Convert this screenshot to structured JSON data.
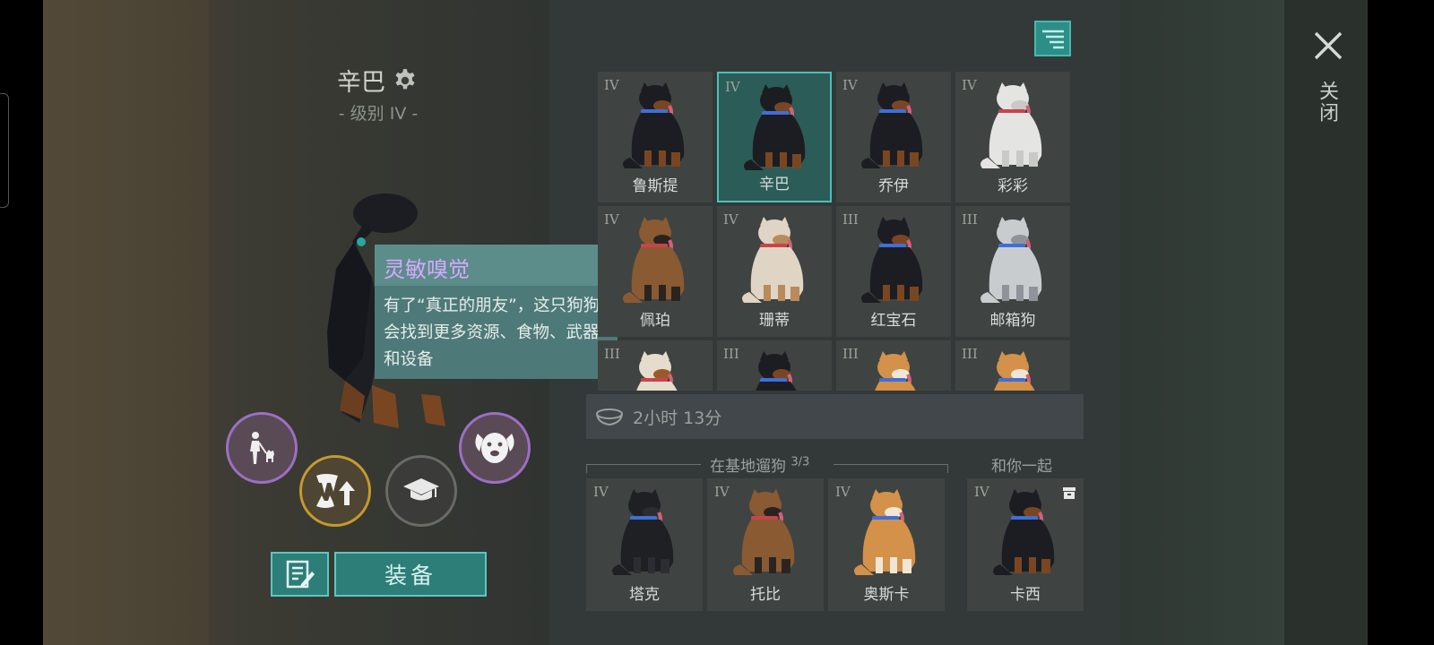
{
  "dog": {
    "name": "辛巴",
    "level": "- 级别 IV -"
  },
  "tooltip": {
    "title": "灵敏嗅觉",
    "body": "有了“真正的朋友”，这只狗狗会找到更多资源、食物、武器和设备"
  },
  "actions": {
    "equip_label": "装备"
  },
  "dogs": [
    {
      "tier": "IV",
      "name": "鲁斯提",
      "icon": "rottweiler-icon"
    },
    {
      "tier": "IV",
      "name": "辛巴",
      "icon": "rottweiler-icon",
      "selected": true
    },
    {
      "tier": "IV",
      "name": "乔伊",
      "icon": "rottweiler-icon"
    },
    {
      "tier": "IV",
      "name": "彩彩",
      "icon": "white-husky-icon"
    },
    {
      "tier": "IV",
      "name": "佩珀",
      "icon": "shepherd-icon"
    },
    {
      "tier": "IV",
      "name": "珊蒂",
      "icon": "husky-icon"
    },
    {
      "tier": "III",
      "name": "红宝石",
      "icon": "rottweiler-icon"
    },
    {
      "tier": "III",
      "name": "邮箱狗",
      "icon": "grey-husky-icon"
    },
    {
      "tier": "III",
      "name": "",
      "icon": "st-bernard-icon"
    },
    {
      "tier": "III",
      "name": "",
      "icon": "rottweiler-icon"
    },
    {
      "tier": "III",
      "name": "",
      "icon": "corgi-icon"
    },
    {
      "tier": "III",
      "name": "",
      "icon": "corgi-icon"
    }
  ],
  "timer": {
    "text": "2小时 13分"
  },
  "walk": {
    "title": "在基地遛狗",
    "count": "3/3"
  },
  "walk_dogs": [
    {
      "tier": "IV",
      "name": "塔克",
      "icon": "black-shepherd-icon"
    },
    {
      "tier": "IV",
      "name": "托比",
      "icon": "shepherd-icon"
    },
    {
      "tier": "IV",
      "name": "奥斯卡",
      "icon": "corgi-icon"
    }
  ],
  "with_you": {
    "title": "和你一起",
    "dog": {
      "tier": "IV",
      "name": "卡西",
      "icon": "rottweiler-icon"
    }
  },
  "close_label": "关闭",
  "colors": {
    "accent": "#2d7d78",
    "accent_border": "#5cc8c0",
    "tooltip_title": "#d7a8ff",
    "skill_ring": "#9d6fc4",
    "upgrade_ring": "#c59a2e"
  }
}
